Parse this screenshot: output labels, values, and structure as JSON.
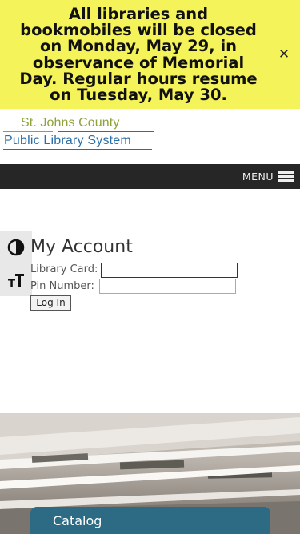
{
  "alert": {
    "text": "All libraries and bookmobiles will be closed on Monday, May 29, in observance of Memorial Day. Regular hours resume on Tuesday, May 30.",
    "close_icon": "close-icon",
    "background": "#f5f35a"
  },
  "logo": {
    "line1": "St. Johns County",
    "line2": "Public Library System",
    "colors": {
      "line1": "#8ba33a",
      "line2": "#2a6ea6"
    }
  },
  "nav": {
    "menu_label": "MENU",
    "menu_icon": "hamburger-icon",
    "background": "#262626"
  },
  "accessibility": {
    "contrast_icon": "contrast-icon",
    "text_size_icon": "text-size-icon"
  },
  "account": {
    "title": "My Account",
    "card_label": "Library Card:",
    "card_value": "",
    "pin_label": "Pin Number:",
    "pin_value": "",
    "login_label": "Log In"
  },
  "hero": {
    "catalog_label": "Catalog",
    "catalog_color": "#2d6b84"
  }
}
